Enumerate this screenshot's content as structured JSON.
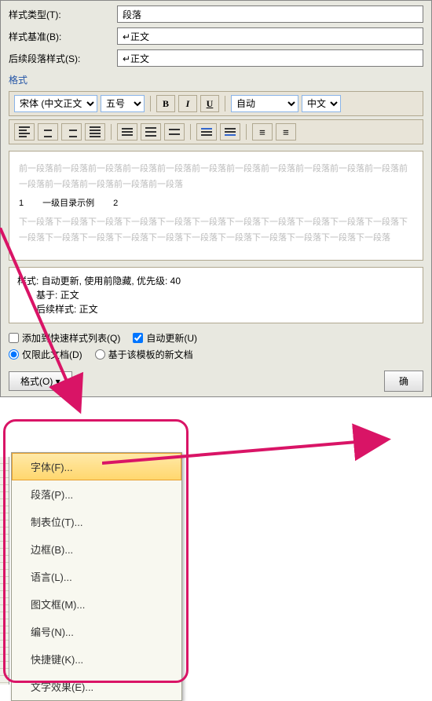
{
  "styleType": {
    "label": "样式类型(T):",
    "value": "段落"
  },
  "styleBase": {
    "label": "样式基准(B):",
    "value": "↵正文"
  },
  "followStyle": {
    "label": "后续段落样式(S):",
    "value": "↵正文"
  },
  "sectionFormat": "格式",
  "fontSelect": "宋体 (中文正文",
  "sizeSelect": "五号",
  "autoLabel": "自动",
  "langSelect": "中文",
  "previewBefore": "前一段落前一段落前一段落前一段落前一段落前一段落前一段落前一段落前一段落前一段落前一段落前一段落前一段落前一段落前一段落前一段落",
  "previewContent": {
    "num1": "1",
    "text": "一级目录示例",
    "num2": "2"
  },
  "previewAfter": "下一段落下一段落下一段落下一段落下一段落下一段落下一段落下一段落下一段落下一段落下一段落下一段落下一段落下一段落下一段落下一段落下一段落下一段落下一段落下一段落下一段落下一段落",
  "styleInfo": {
    "line1": "样式: 自动更新, 使用前隐藏, 优先级: 40",
    "line2": "　　基于: 正文",
    "line3": "　　后续样式: 正文"
  },
  "addToQuickList": "添加到快速样式列表(Q)",
  "autoUpdate": "自动更新(U)",
  "onlyThisDoc": "仅限此文档(D)",
  "basedOnTemplate": "基于该模板的新文档",
  "formatButton": "格式(O) ▾",
  "okButton": "确",
  "menu": {
    "font": "字体(F)...",
    "paragraph": "段落(P)...",
    "tabs": "制表位(T)...",
    "border": "边框(B)...",
    "language": "语言(L)...",
    "frame": "图文框(M)...",
    "numbering": "编号(N)...",
    "shortcut": "快捷键(K)...",
    "textEffect": "文字效果(E)..."
  }
}
